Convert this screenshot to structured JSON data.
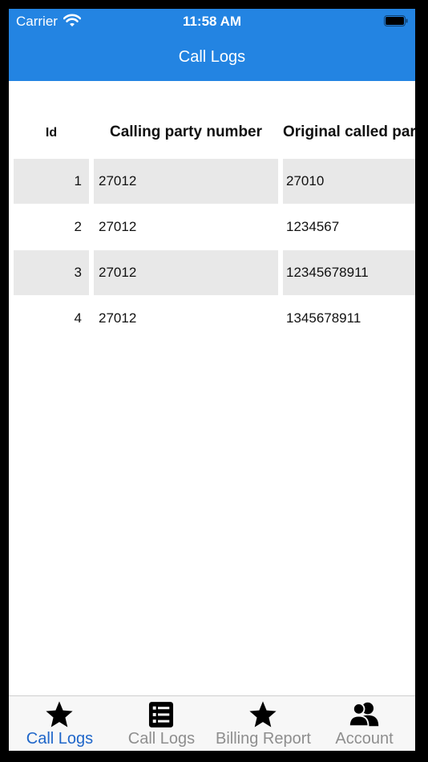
{
  "status_bar": {
    "carrier": "Carrier",
    "time": "11:58 AM"
  },
  "nav": {
    "title": "Call Logs"
  },
  "table": {
    "headers": {
      "id": "Id",
      "calling": "Calling party number",
      "original": "Original called par"
    },
    "rows": [
      {
        "id": "1",
        "calling": "27012",
        "original": "27010"
      },
      {
        "id": "2",
        "calling": "27012",
        "original": "1234567"
      },
      {
        "id": "3",
        "calling": "27012",
        "original": "12345678911"
      },
      {
        "id": "4",
        "calling": "27012",
        "original": "1345678911"
      }
    ]
  },
  "tabs": [
    {
      "label": "Call Logs",
      "icon": "star-icon",
      "active": true
    },
    {
      "label": "Call Logs",
      "icon": "list-icon",
      "active": false
    },
    {
      "label": "Billing Report",
      "icon": "star-icon",
      "active": false
    },
    {
      "label": "Account",
      "icon": "users-icon",
      "active": false
    }
  ],
  "colors": {
    "header": "#2384e2",
    "active_tab": "#1f66c9",
    "inactive_tab": "#8e8e8e",
    "row_shade": "#e8e8e8"
  }
}
